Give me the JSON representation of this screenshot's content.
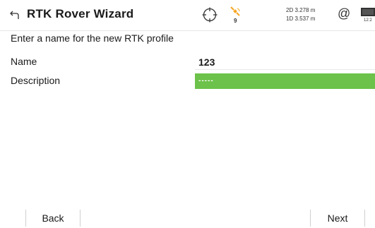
{
  "header": {
    "title": "RTK Rover Wizard",
    "back_icon": "back-arrow-icon",
    "crosshair_icon": "crosshair-icon",
    "satellite_icon": "satellite-icon",
    "satellite_count": "9",
    "accuracy_2d": "2D 3.278 m",
    "accuracy_1d": "1D 3.537 m",
    "at_icon": "@",
    "battery_icon": "battery-icon",
    "time": "12:2"
  },
  "form": {
    "prompt": "Enter a name for the new RTK profile",
    "name_label": "Name",
    "name_value": "123",
    "description_label": "Description",
    "description_value": "-----"
  },
  "footer": {
    "back_label": "Back",
    "next_label": "Next"
  },
  "colors": {
    "accent_green": "#6cc24a",
    "satellite_orange": "#f5a623"
  }
}
